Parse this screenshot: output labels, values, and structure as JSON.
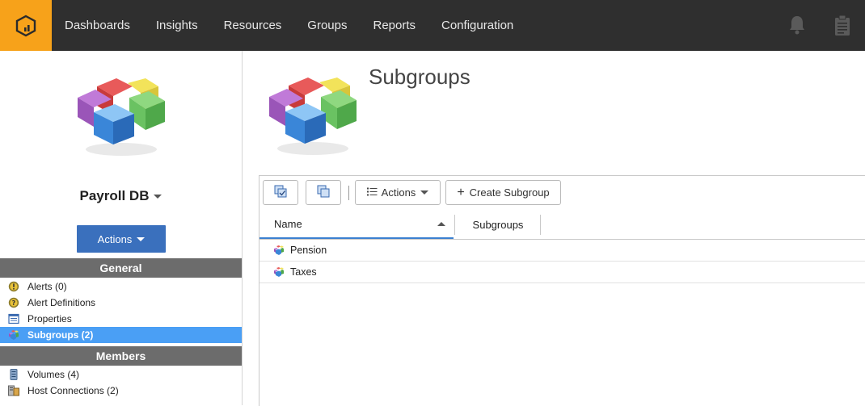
{
  "header": {
    "logo_icon": "monitor-logo-icon",
    "nav": [
      "Dashboards",
      "Insights",
      "Resources",
      "Groups",
      "Reports",
      "Configuration"
    ],
    "icons": [
      "bell-icon",
      "clipboard-icon"
    ]
  },
  "left": {
    "group_name": "Payroll DB",
    "actions_label": "Actions",
    "sections": [
      {
        "title": "General",
        "items": [
          {
            "label": "Alerts (0)",
            "icon": "alert-icon"
          },
          {
            "label": "Alert Definitions",
            "icon": "alert-definition-icon"
          },
          {
            "label": "Properties",
            "icon": "properties-icon"
          },
          {
            "label": "Subgroups (2)",
            "icon": "subgroups-icon",
            "active": true
          }
        ]
      },
      {
        "title": "Members",
        "items": [
          {
            "label": "Volumes (4)",
            "icon": "volume-icon"
          },
          {
            "label": "Host Connections (2)",
            "icon": "host-connection-icon"
          }
        ]
      }
    ]
  },
  "main": {
    "title": "Subgroups",
    "toolbar": {
      "actions_label": "Actions",
      "create_label": "Create Subgroup"
    },
    "columns": [
      "Name",
      "Subgroups"
    ],
    "rows": [
      {
        "name": "Pension",
        "subgroups": ""
      },
      {
        "name": "Taxes",
        "subgroups": ""
      }
    ]
  },
  "colors": {
    "topbar": "#2f2f2f",
    "logo_bg": "#f7a21a",
    "primary_button": "#3a70bd",
    "active_row": "#4a9ff5",
    "section_header": "#6c6c6c"
  }
}
